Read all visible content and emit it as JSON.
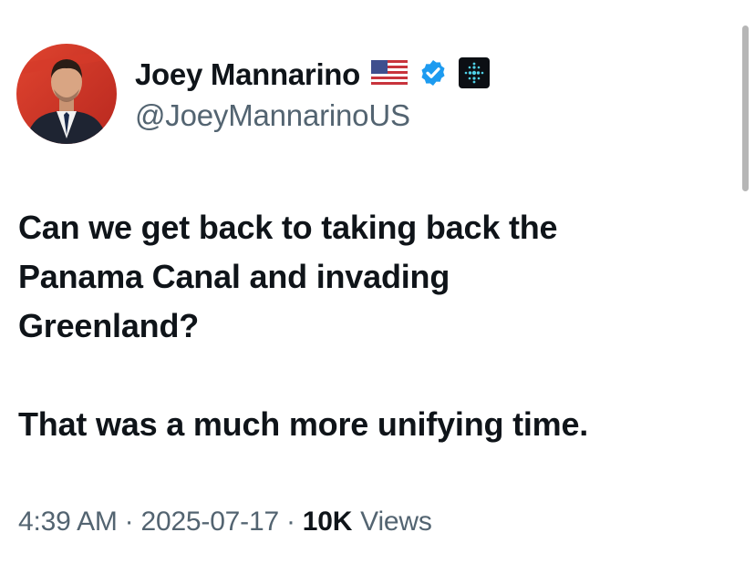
{
  "author": {
    "display_name": "Joey Mannarino",
    "handle": "@JoeyMannarinoUS",
    "flag_icon": "us-flag-icon",
    "verified_icon": "verified-badge-icon",
    "affiliate_icon": "affiliate-badge-icon",
    "verified_color": "#1d9bf0"
  },
  "tweet": {
    "line1": "Can we get back to taking back the",
    "line2": "Panama Canal and invading",
    "line3": "Greenland?",
    "line4": "That was a much more unifying time."
  },
  "meta": {
    "time": "4:39 AM",
    "separator": "·",
    "date": "2025-07-17",
    "views_count": "10K",
    "views_label": "Views"
  }
}
